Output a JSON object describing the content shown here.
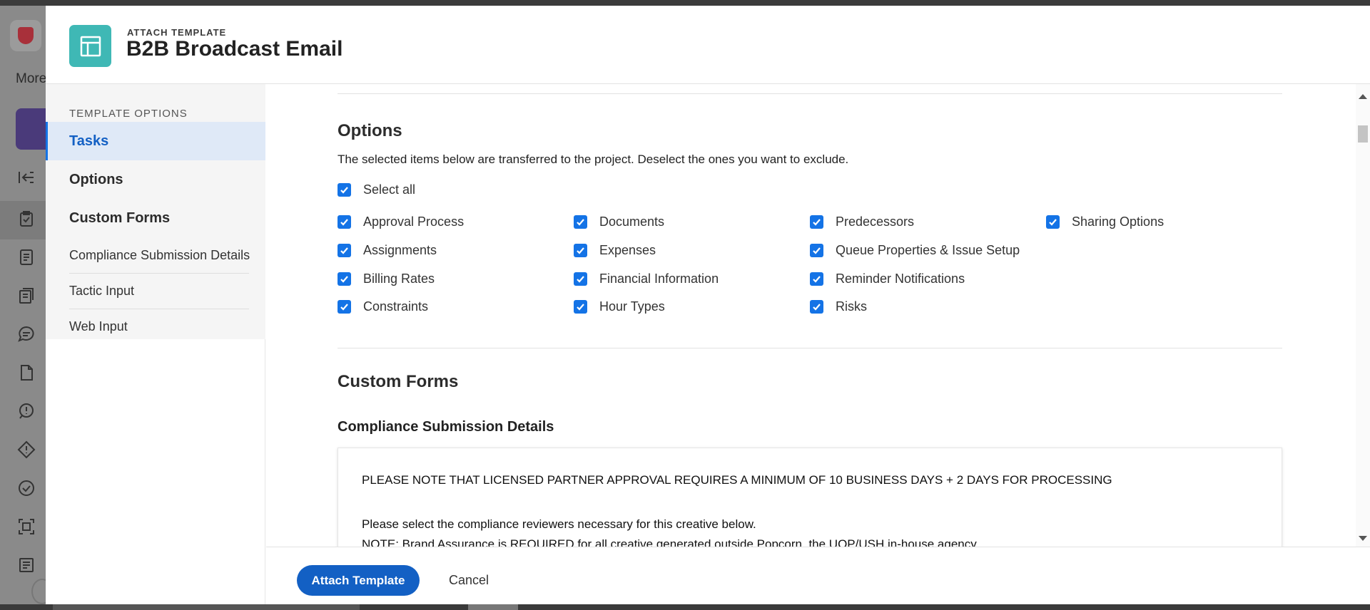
{
  "background_app": {
    "more_label": "More"
  },
  "header": {
    "eyebrow": "ATTACH TEMPLATE",
    "title": "B2B Broadcast Email"
  },
  "sidebar": {
    "heading": "TEMPLATE OPTIONS",
    "items": [
      {
        "label": "Tasks",
        "active": true
      },
      {
        "label": "Options",
        "active": false
      },
      {
        "label": "Custom Forms",
        "active": false
      }
    ],
    "sub_items": [
      {
        "label": "Compliance Submission Details"
      },
      {
        "label": "Tactic Input"
      },
      {
        "label": "Web Input"
      }
    ]
  },
  "options": {
    "title": "Options",
    "description": "The selected items below are transferred to the project. Deselect the ones you want to exclude.",
    "select_all": {
      "label": "Select all",
      "checked": true
    },
    "columns": [
      [
        {
          "label": "Approval Process",
          "checked": true
        },
        {
          "label": "Assignments",
          "checked": true
        },
        {
          "label": "Billing Rates",
          "checked": true
        },
        {
          "label": "Constraints",
          "checked": true
        }
      ],
      [
        {
          "label": "Documents",
          "checked": true
        },
        {
          "label": "Expenses",
          "checked": true
        },
        {
          "label": "Financial Information",
          "checked": true
        },
        {
          "label": "Hour Types",
          "checked": true
        }
      ],
      [
        {
          "label": "Predecessors",
          "checked": true
        },
        {
          "label": "Queue Properties & Issue Setup",
          "checked": true
        },
        {
          "label": "Reminder Notifications",
          "checked": true
        },
        {
          "label": "Risks",
          "checked": true
        }
      ],
      [
        {
          "label": "Sharing Options",
          "checked": true
        }
      ]
    ]
  },
  "custom_forms": {
    "title": "Custom Forms",
    "compliance": {
      "title": "Compliance Submission Details",
      "note_lines": [
        "PLEASE NOTE THAT LICENSED PARTNER APPROVAL REQUIRES A MINIMUM OF 10 BUSINESS DAYS + 2 DAYS FOR PROCESSING",
        "Please select the compliance reviewers necessary for this creative below.",
        "NOTE: Brand Assurance is REQUIRED for all creative generated outside Popcorn, the UOP/USH in-house agency."
      ]
    }
  },
  "footer": {
    "attach_label": "Attach Template",
    "cancel_label": "Cancel"
  },
  "colors": {
    "accent": "#1473e6",
    "primary_button": "#1360c4",
    "template_icon": "#3fb8b5",
    "active_nav_bg": "#dfe9f7"
  }
}
